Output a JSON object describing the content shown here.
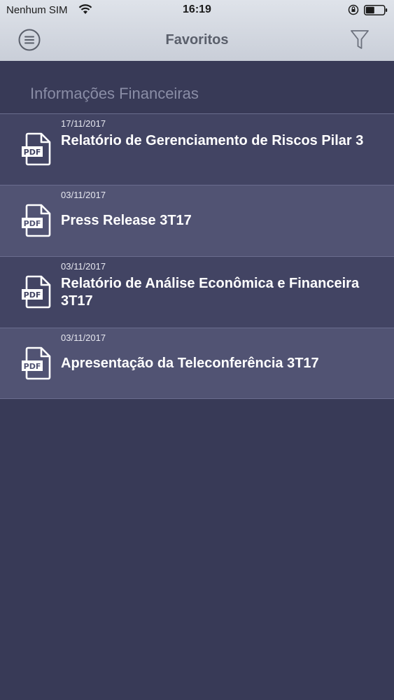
{
  "status_bar": {
    "carrier": "Nenhum SIM",
    "time": "16:19"
  },
  "header": {
    "title": "Favoritos",
    "menu_icon": "menu-icon",
    "filter_icon": "filter-icon"
  },
  "section": {
    "title": "Informações Financeiras"
  },
  "items": [
    {
      "date": "17/11/2017",
      "title": " Relatório de Gerenciamento de Riscos Pilar 3",
      "icon": "pdf-icon"
    },
    {
      "date": "03/11/2017",
      "title": "Press Release 3T17",
      "icon": "pdf-icon"
    },
    {
      "date": "03/11/2017",
      "title": "Relatório de Análise Econômica e Financeira 3T17",
      "icon": "pdf-icon"
    },
    {
      "date": "03/11/2017",
      "title": "Apresentação da Teleconferência 3T17",
      "icon": "pdf-icon"
    }
  ],
  "colors": {
    "header_bg": "#d6dae2",
    "content_bg": "#383a57",
    "item_dark": "#424463",
    "item_light": "#515373",
    "text_white": "#ffffff",
    "section_title": "#8a8da6"
  }
}
